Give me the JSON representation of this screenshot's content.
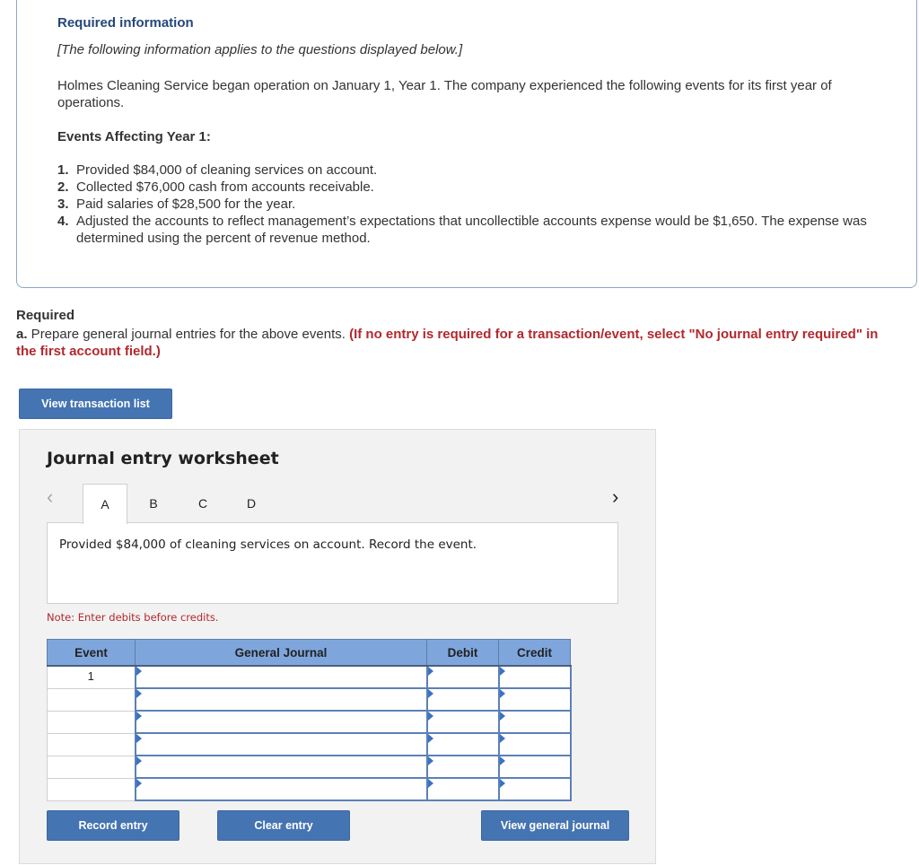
{
  "info": {
    "title": "Required information",
    "note": "[The following information applies to the questions displayed below.]",
    "intro": "Holmes Cleaning Service began operation on January 1, Year 1. The company experienced the following events for its first year of operations.",
    "events_title": "Events Affecting Year 1:",
    "events": [
      {
        "num": "1.",
        "text": "Provided $84,000 of cleaning services on account."
      },
      {
        "num": "2.",
        "text": "Collected $76,000 cash from accounts receivable."
      },
      {
        "num": "3.",
        "text": "Paid salaries of $28,500 for the year."
      },
      {
        "num": "4.",
        "text": "Adjusted the accounts to reflect management’s expectations that uncollectible accounts expense would be $1,650. The expense was determined using the percent of revenue method."
      }
    ]
  },
  "required": {
    "title": "Required",
    "label": "a.",
    "text": " Prepare general journal entries for the above events. ",
    "instruction": "(If no entry is required for a transaction/event, select \"No journal entry required\" in the first account field.)"
  },
  "buttons": {
    "view_transaction_list": "View transaction list",
    "record_entry": "Record entry",
    "clear_entry": "Clear entry",
    "view_general_journal": "View general journal"
  },
  "worksheet": {
    "title": "Journal entry worksheet",
    "prev_icon": "‹",
    "next_icon": "›",
    "tabs": [
      "A",
      "B",
      "C",
      "D"
    ],
    "active_tab": "A",
    "description": "Provided $84,000 of cleaning services on account. Record the event.",
    "note": "Note: Enter debits before credits.",
    "table": {
      "headers": [
        "Event",
        "General Journal",
        "Debit",
        "Credit"
      ],
      "rows": [
        {
          "event": "1",
          "account": "",
          "debit": "",
          "credit": ""
        },
        {
          "event": "",
          "account": "",
          "debit": "",
          "credit": ""
        },
        {
          "event": "",
          "account": "",
          "debit": "",
          "credit": ""
        },
        {
          "event": "",
          "account": "",
          "debit": "",
          "credit": ""
        },
        {
          "event": "",
          "account": "",
          "debit": "",
          "credit": ""
        },
        {
          "event": "",
          "account": "",
          "debit": "",
          "credit": ""
        }
      ]
    }
  },
  "colors": {
    "accent_blue": "#4574b2",
    "header_blue": "#7fa6dc",
    "title_blue": "#24477a",
    "warning_red": "#b3282d"
  }
}
